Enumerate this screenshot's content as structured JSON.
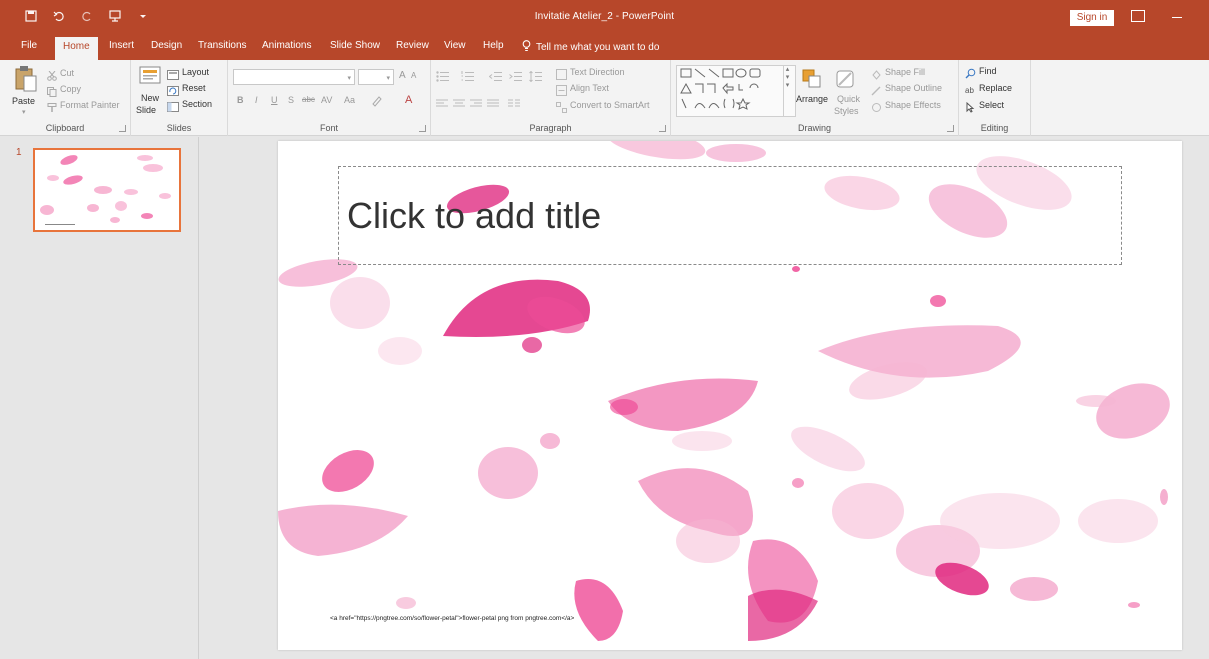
{
  "window": {
    "title": "Invitatie Atelier_2  -  PowerPoint",
    "sign_in": "Sign in"
  },
  "tabs": [
    "File",
    "Home",
    "Insert",
    "Design",
    "Transitions",
    "Animations",
    "Slide Show",
    "Review",
    "View",
    "Help"
  ],
  "active_tab": "Home",
  "tell_me": "Tell me what you want to do",
  "ribbon": {
    "clipboard": {
      "label": "Clipboard",
      "paste": "Paste",
      "cut": "Cut",
      "copy": "Copy",
      "format_painter": "Format Painter"
    },
    "slides": {
      "label": "Slides",
      "new_slide_1": "New",
      "new_slide_2": "Slide",
      "layout": "Layout",
      "reset": "Reset",
      "section": "Section"
    },
    "font": {
      "label": "Font",
      "bold": "B",
      "italic": "I",
      "underline": "U",
      "shadow": "S",
      "strike": "abc",
      "spacing": "AV",
      "case": "Aa",
      "color": "A",
      "grow": "A",
      "shrink": "A"
    },
    "paragraph": {
      "label": "Paragraph",
      "text_direction": "Text Direction",
      "align_text": "Align Text",
      "smartart": "Convert to SmartArt"
    },
    "drawing": {
      "label": "Drawing",
      "arrange": "Arrange",
      "quick_styles_1": "Quick",
      "quick_styles_2": "Styles",
      "shape_fill": "Shape Fill",
      "shape_outline": "Shape Outline",
      "shape_effects": "Shape Effects"
    },
    "editing": {
      "label": "Editing",
      "find": "Find",
      "replace": "Replace",
      "select": "Select"
    }
  },
  "slides_pane": {
    "slide_number": "1"
  },
  "slide": {
    "title_placeholder": "Click to add title",
    "footer_text": "<a href=\"https://pngtree.com/so/flower-petal\">flower-petal png from pngtree.com</a>"
  },
  "colors": {
    "accent": "#b7472a",
    "petal": "#ee3f8f"
  }
}
